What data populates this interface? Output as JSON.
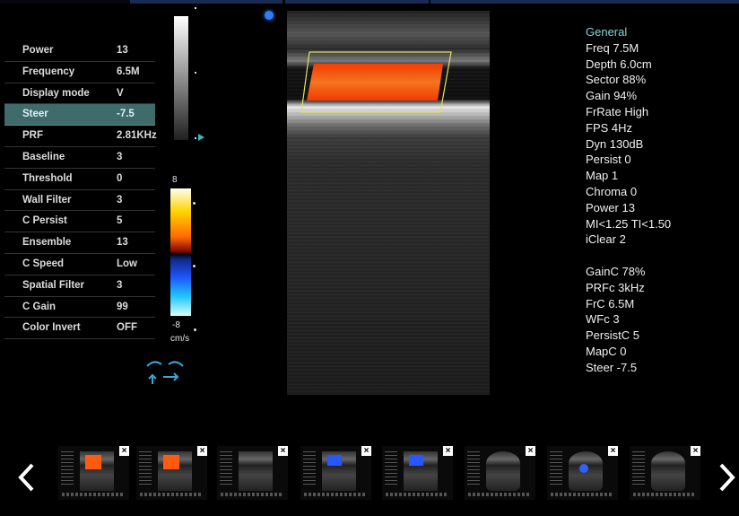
{
  "params": [
    {
      "label": "Power",
      "value": "13",
      "selected": false
    },
    {
      "label": "Frequency",
      "value": "6.5M",
      "selected": false
    },
    {
      "label": "Display mode",
      "value": "V",
      "selected": false
    },
    {
      "label": "Steer",
      "value": "-7.5",
      "selected": true
    },
    {
      "label": "PRF",
      "value": "2.81KHz",
      "selected": false
    },
    {
      "label": "Baseline",
      "value": "3",
      "selected": false
    },
    {
      "label": "Threshold",
      "value": "0",
      "selected": false
    },
    {
      "label": "Wall Filter",
      "value": "3",
      "selected": false
    },
    {
      "label": "C Persist",
      "value": "5",
      "selected": false
    },
    {
      "label": "Ensemble",
      "value": "13",
      "selected": false
    },
    {
      "label": "C Speed",
      "value": "Low",
      "selected": false
    },
    {
      "label": "Spatial Filter",
      "value": "3",
      "selected": false
    },
    {
      "label": "C Gain",
      "value": "99",
      "selected": false
    },
    {
      "label": "Color Invert",
      "value": "OFF",
      "selected": false
    }
  ],
  "colorbar": {
    "max": "8",
    "min": "-8",
    "unit": "cm/s"
  },
  "info": {
    "header": "General",
    "general": [
      "Freq 7.5M",
      "Depth 6.0cm",
      "Sector 88%",
      "Gain 94%",
      "FrRate High",
      "FPS 4Hz",
      "Dyn 130dB",
      "Persist 0",
      "Map 1",
      "Chroma 0",
      "Power 13",
      "MI<1.25  TI<1.50",
      "iClear 2"
    ],
    "color": [
      "GainC 78%",
      "PRFc 3kHz",
      "FrC 6.5M",
      "WFc 3",
      "PersistC 5",
      "MapC 0",
      "Steer -7.5"
    ]
  },
  "thumbnails": [
    {
      "kind": "color-doppler-red",
      "close": "×"
    },
    {
      "kind": "color-doppler-red",
      "close": "×"
    },
    {
      "kind": "b-mode",
      "close": "×"
    },
    {
      "kind": "color-doppler-blue",
      "close": "×"
    },
    {
      "kind": "color-doppler-blue",
      "close": "×"
    },
    {
      "kind": "b-mode-sector",
      "close": "×"
    },
    {
      "kind": "color-doppler-sector",
      "close": "×"
    },
    {
      "kind": "b-mode-sector",
      "close": "×"
    }
  ],
  "icons": {
    "prev": "chevron-left-icon",
    "next": "chevron-right-icon",
    "probe": "probe-steer-icon",
    "close": "close-icon"
  },
  "colors": {
    "accent": "#7fd6d6",
    "selected_row": "#3f6b6b",
    "roi_border": "#e0e060",
    "flow": "#ff5a10"
  }
}
